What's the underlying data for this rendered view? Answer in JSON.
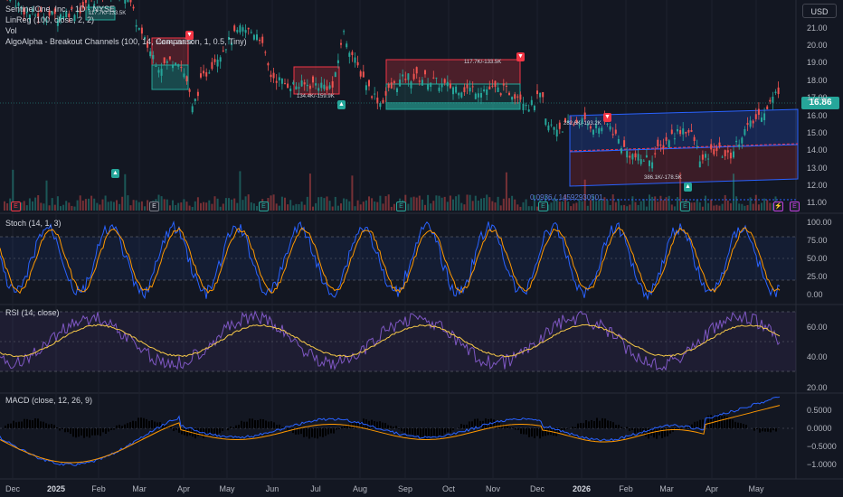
{
  "legend": {
    "title": "SentinelOne, Inc. · 1D · NYSE",
    "linreg": "LinReg (100, close, 2, 2)",
    "vol": "Vol",
    "algo": "AlgoAlpha - Breakout Channels (100, 14, Comparison, 1, 0.5, Tiny)"
  },
  "currency": "USD",
  "last_price": "16.86",
  "price_axis": [
    "21.00",
    "20.00",
    "19.00",
    "18.00",
    "17.00",
    "16.00",
    "15.00",
    "14.00",
    "13.00",
    "12.00",
    "11.00"
  ],
  "stoch": {
    "label": "Stoch (14, 1, 3)",
    "axis": [
      "100.00",
      "75.00",
      "50.00",
      "25.00",
      "0.00"
    ]
  },
  "rsi": {
    "label": "RSI (14, close)",
    "axis": [
      "60.00",
      "40.00",
      "20.00"
    ]
  },
  "macd": {
    "label": "MACD (close, 12, 26, 9)",
    "axis": [
      "0.5000",
      "0.0000",
      "−0.5000",
      "−1.0000"
    ]
  },
  "x_axis": [
    {
      "label": "Dec",
      "bold": false
    },
    {
      "label": "2025",
      "bold": true
    },
    {
      "label": "Feb",
      "bold": false
    },
    {
      "label": "Mar",
      "bold": false
    },
    {
      "label": "Apr",
      "bold": false
    },
    {
      "label": "May",
      "bold": false
    },
    {
      "label": "Jun",
      "bold": false
    },
    {
      "label": "Jul",
      "bold": false
    },
    {
      "label": "Aug",
      "bold": false
    },
    {
      "label": "Sep",
      "bold": false
    },
    {
      "label": "Oct",
      "bold": false
    },
    {
      "label": "Nov",
      "bold": false
    },
    {
      "label": "Dec",
      "bold": false
    },
    {
      "label": "2026",
      "bold": true
    },
    {
      "label": "Feb",
      "bold": false
    },
    {
      "label": "Mar",
      "bold": false
    },
    {
      "label": "Apr",
      "bold": false
    },
    {
      "label": "May",
      "bold": false
    }
  ],
  "channel_labels": [
    "117.7K/-133.5K",
    "134.4K/-159.9K",
    "117.7K/-133.5K",
    "282.6K/-193.2K",
    "386.1K/-178.5K",
    "108.4K/-233.1K"
  ],
  "fib_label": "0.0936 (.14592930501",
  "earnings_marker": "E",
  "colors": {
    "up": "#26a69a",
    "down": "#ef5350",
    "channel_blue": "#2962ff",
    "channel_red": "#f23645"
  }
}
